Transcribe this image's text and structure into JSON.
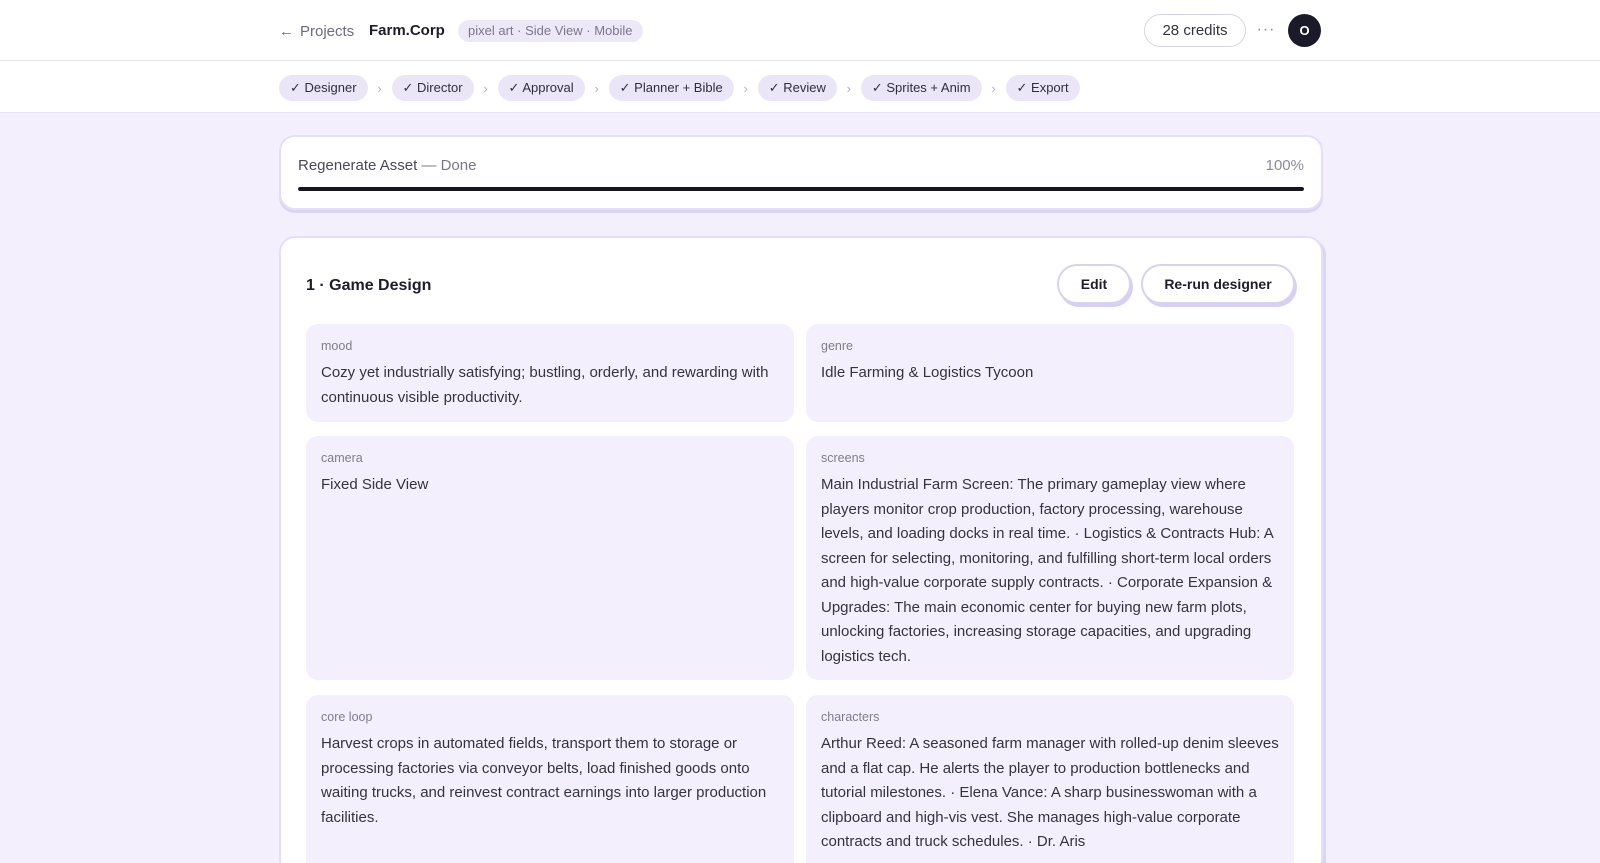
{
  "header": {
    "back_label": "Projects",
    "back_arrow": "←",
    "project_name": "Farm.Corp",
    "project_tag": "pixel art · Side View · Mobile",
    "credits": "28 credits",
    "more": "···",
    "avatar_initial": "O"
  },
  "steps": [
    "✓ Designer",
    "✓ Director",
    "✓ Approval",
    "✓ Planner + Bible",
    "✓ Review",
    "✓ Sprites + Anim",
    "✓ Export"
  ],
  "step_separator": "›",
  "progress": {
    "label": "Regenerate Asset",
    "status": "— Done",
    "percent_label": "100%",
    "value": 1.0
  },
  "design": {
    "title": "1 · Game Design",
    "edit_label": "Edit",
    "rerun_label": "Re-run designer",
    "fields": {
      "mood": {
        "label": "mood",
        "value": "Cozy yet industrially satisfying; bustling, orderly, and rewarding with continuous visible productivity."
      },
      "genre": {
        "label": "genre",
        "value": "Idle Farming & Logistics Tycoon"
      },
      "camera": {
        "label": "camera",
        "value": "Fixed Side View"
      },
      "screens": {
        "label": "screens",
        "value": "Main Industrial Farm Screen: The primary gameplay view where players monitor crop production, factory processing, warehouse levels, and loading docks in real time. · Logistics & Contracts Hub: A screen for selecting, monitoring, and fulfilling short-term local orders and high-value corporate supply contracts. · Corporate Expansion & Upgrades: The main economic center for buying new farm plots, unlocking factories, increasing storage capacities, and upgrading logistics tech."
      },
      "core_loop": {
        "label": "core loop",
        "value": "Harvest crops in automated fields, transport them to storage or processing factories via conveyor belts, load finished goods onto waiting trucks, and reinvest contract earnings into larger production facilities."
      },
      "characters": {
        "label": "characters",
        "value": "Arthur Reed: A seasoned farm manager with rolled-up denim sleeves and a flat cap. He alerts the player to production bottlenecks and tutorial milestones. · Elena Vance: A sharp businesswoman with a clipboard and high-vis vest. She manages high-value corporate contracts and truck schedules. · Dr. Aris"
      }
    }
  }
}
